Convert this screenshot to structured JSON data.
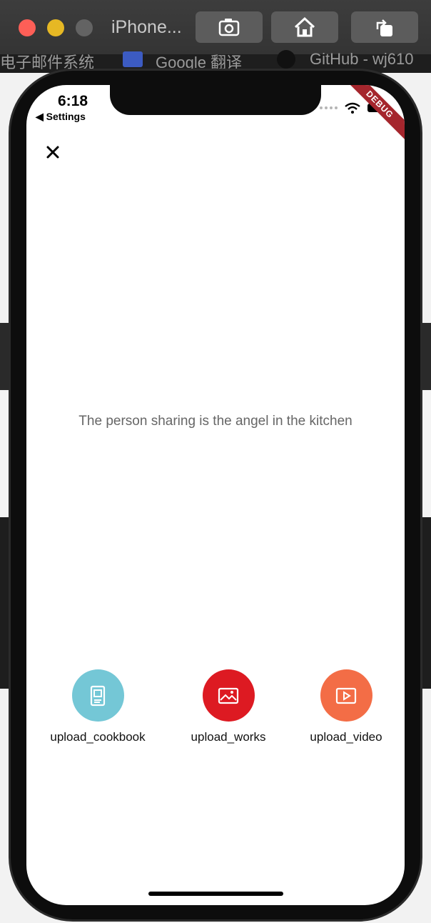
{
  "window": {
    "title": "iPhone...",
    "buttons": [
      "screenshot-icon",
      "home-icon",
      "rotate-icon"
    ]
  },
  "bookmarks": [
    {
      "label": "电子邮件系统"
    },
    {
      "label": "Google 翻译",
      "icon": "google-translate-icon"
    },
    {
      "label": "GitHub - wj610",
      "icon": "github-icon"
    }
  ],
  "status_bar": {
    "time": "6:18",
    "back_label": "◀ Settings",
    "debug_banner": "DEBUG"
  },
  "page": {
    "slogan": "The person sharing is the angel in the kitchen",
    "close_icon": "close-icon"
  },
  "actions": [
    {
      "label": "upload_cookbook",
      "icon": "cookbook-icon",
      "color": "#74c7d6"
    },
    {
      "label": "upload_works",
      "icon": "image-icon",
      "color": "#dd1a22"
    },
    {
      "label": "upload_video",
      "icon": "video-icon",
      "color": "#f36d46"
    }
  ]
}
